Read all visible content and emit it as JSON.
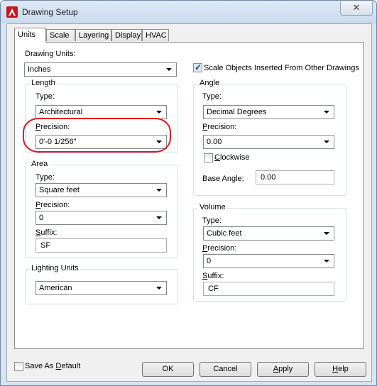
{
  "window": {
    "title": "Drawing Setup",
    "close_glyph": "✕"
  },
  "tabs": [
    "Units",
    "Scale",
    "Layering",
    "Display",
    "HVAC"
  ],
  "drawing_units": {
    "label": "Drawing Units:",
    "value": "Inches"
  },
  "scale_objects": {
    "label": "Scale Objects Inserted From Other Drawings",
    "checked": true
  },
  "length": {
    "title": "Length",
    "type_label": "Type:",
    "type_value": "Architectural",
    "precision_label": "Precision:",
    "precision_value": "0'-0 1/256\""
  },
  "angle": {
    "title": "Angle",
    "type_label": "Type:",
    "type_value": "Decimal Degrees",
    "precision_label": "Precision:",
    "precision_value": "0.00",
    "clockwise_label": "Clockwise",
    "clockwise_checked": false,
    "base_angle_label": "Base Angle:",
    "base_angle_value": "0.00"
  },
  "area": {
    "title": "Area",
    "type_label": "Type:",
    "type_value": "Square feet",
    "precision_label": "Precision:",
    "precision_value": "0",
    "suffix_label": "Suffix:",
    "suffix_value": "SF"
  },
  "volume": {
    "title": "Volume",
    "type_label": "Type:",
    "type_value": "Cubic feet",
    "precision_label": "Precision:",
    "precision_value": "0",
    "suffix_label": "Suffix:",
    "suffix_value": "CF"
  },
  "lighting": {
    "title": "Lighting Units",
    "value": "American"
  },
  "save_default": {
    "label": "Save As Default",
    "checked": false
  },
  "buttons": {
    "ok": "OK",
    "cancel": "Cancel",
    "apply": "Apply",
    "help": "Help"
  },
  "annotation_color": "#e2141b",
  "icons": {
    "app": "autocad-a-icon",
    "close": "close-icon",
    "dropdown": "chevron-down-icon"
  }
}
